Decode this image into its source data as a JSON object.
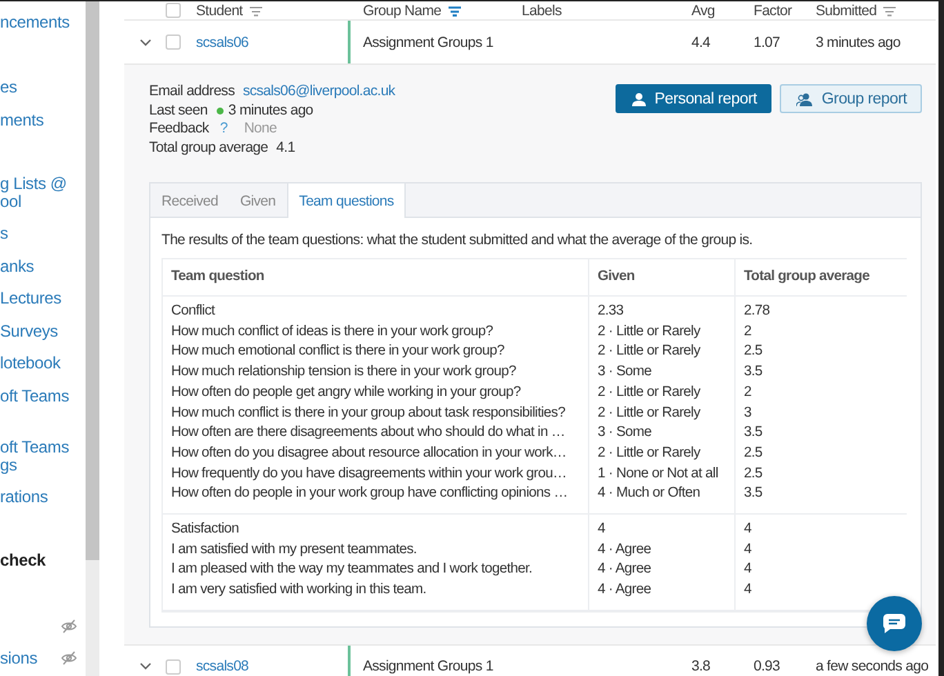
{
  "sidebar": {
    "items": [
      {
        "label": "ncements",
        "kind": "link",
        "hidden": false
      },
      {
        "label": "es",
        "kind": "link",
        "hidden": false
      },
      {
        "label": "ments",
        "kind": "link",
        "hidden": false
      },
      {
        "label": "g Lists @\nool",
        "kind": "link",
        "hidden": false
      },
      {
        "label": "s",
        "kind": "link",
        "hidden": false
      },
      {
        "label": "anks",
        "kind": "link",
        "hidden": false
      },
      {
        "label": "Lectures",
        "kind": "link",
        "hidden": false
      },
      {
        "label": "Surveys",
        "kind": "link",
        "hidden": false
      },
      {
        "label": "lotebook",
        "kind": "link",
        "hidden": false
      },
      {
        "label": "oft Teams",
        "kind": "link",
        "hidden": false
      },
      {
        "label": "oft Teams\ngs",
        "kind": "link",
        "hidden": false
      },
      {
        "label": "rations",
        "kind": "link",
        "hidden": false
      },
      {
        "label": "check",
        "kind": "heading",
        "hidden": false
      },
      {
        "kind": "link",
        "hidden": true
      },
      {
        "label": "sions",
        "kind": "link",
        "hidden": true
      }
    ]
  },
  "table": {
    "all_checked": false,
    "columns": [
      {
        "label": "Student",
        "sorted": false
      },
      {
        "label": "Group Name",
        "sorted": true
      },
      {
        "label": "Labels"
      },
      {
        "label": "Avg"
      },
      {
        "label": "Factor"
      },
      {
        "label": "Submitted",
        "sorted": false
      }
    ],
    "rows": [
      {
        "student": "scsals06",
        "group": "Assignment Groups 1",
        "avg": "4.4",
        "factor": "1.07",
        "submitted": "3 minutes ago",
        "checked": false,
        "expanded": true,
        "details": {
          "email_label": "Email address",
          "email": "scsals06@liverpool.ac.uk",
          "last_seen_label": "Last seen",
          "online": true,
          "last_seen": "3 minutes ago",
          "feedback_label": "Feedback",
          "feedback_help": "?",
          "feedback": "None",
          "average_label": "Total group average",
          "average": "4.1",
          "buttons": [
            {
              "label": "Personal report",
              "primary": true
            },
            {
              "label": "Group report",
              "primary": false
            }
          ],
          "tabs": [
            {
              "label": "Received",
              "selected": false
            },
            {
              "label": "Given",
              "selected": false
            },
            {
              "label": "Team questions",
              "selected": true
            }
          ],
          "description": "The results of the team questions: what the student submitted and what the average of the group is.",
          "team_table": {
            "columns": [
              "Team question",
              "Given",
              "Total group average"
            ],
            "groups": [
              {
                "title": "Conflict",
                "given": "2.33",
                "average": "2.78",
                "rows": [
                  {
                    "question": "How much conflict of ideas is there in your work group?",
                    "given": "2 · Little or Rarely",
                    "average": "2"
                  },
                  {
                    "question": "How much emotional conflict is there in your work group?",
                    "given": "2 · Little or Rarely",
                    "average": "2.5"
                  },
                  {
                    "question": "How much relationship tension is there in your work group?",
                    "given": "3 · Some",
                    "average": "3.5"
                  },
                  {
                    "question": "How often do people get angry while working in your group?",
                    "given": "2 · Little or Rarely",
                    "average": "2"
                  },
                  {
                    "question": "How much conflict is there in your group about task responsibilities?",
                    "given": "2 · Little or Rarely",
                    "average": "3"
                  },
                  {
                    "question": "How often are there disagreements about who should do what in …",
                    "given": "3 · Some",
                    "average": "3.5"
                  },
                  {
                    "question": "How often do you disagree about resource allocation in your work…",
                    "given": "2 · Little or Rarely",
                    "average": "2.5"
                  },
                  {
                    "question": "How frequently do you have disagreements within your work grou…",
                    "given": "1 · None or Not at all",
                    "average": "2.5"
                  },
                  {
                    "question": "How often do people in your work group have conflicting opinions …",
                    "given": "4 · Much or Often",
                    "average": "3.5"
                  }
                ]
              },
              {
                "title": "Satisfaction",
                "given": "4",
                "average": "4",
                "rows": [
                  {
                    "question": "I am satisfied with my present teammates.",
                    "given": "4 · Agree",
                    "average": "4"
                  },
                  {
                    "question": "I am pleased with the way my teammates and I work together.",
                    "given": "4 · Agree",
                    "average": "4"
                  },
                  {
                    "question": "I am very satisfied with working in this team.",
                    "given": "4 · Agree",
                    "average": "4"
                  }
                ]
              }
            ]
          }
        }
      },
      {
        "student": "scsals08",
        "group": "Assignment Groups 1",
        "avg": "3.8",
        "factor": "0.93",
        "submitted": "a few seconds ago",
        "checked": false,
        "expanded": true
      }
    ]
  }
}
